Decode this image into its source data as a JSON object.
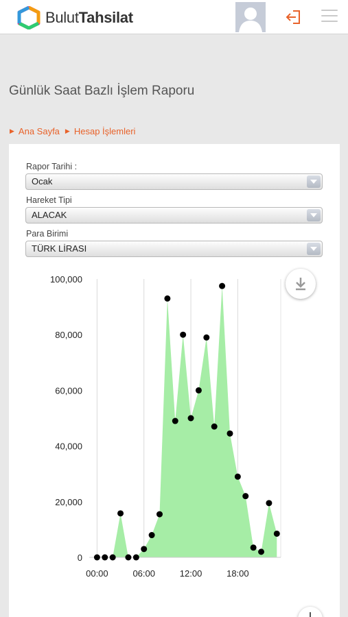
{
  "header": {
    "logo_text_regular": "Bulut",
    "logo_text_bold": "Tahsilat"
  },
  "icons": {
    "logo": "hexagon-logo-icon",
    "avatar": "user-avatar-icon",
    "logout": "logout-icon",
    "menu": "hamburger-menu-icon",
    "download": "download-icon",
    "zoom": "plus-icon"
  },
  "page": {
    "title": "Günlük Saat Bazlı İşlem Raporu"
  },
  "breadcrumb": {
    "items": [
      "Ana Sayfa",
      "Hesap İşlemleri"
    ]
  },
  "form": {
    "report_date": {
      "label": "Rapor Tarihi :",
      "value": "Ocak"
    },
    "movement_type": {
      "label": "Hareket Tipi",
      "value": "ALACAK"
    },
    "currency": {
      "label": "Para Birimi",
      "value": "TÜRK LİRASI"
    }
  },
  "colors": {
    "accent": "#e8622a",
    "area_fill": "#a6eda6",
    "point": "#000000"
  },
  "chart_data": {
    "type": "area",
    "x": [
      0,
      1,
      2,
      3,
      4,
      5,
      6,
      7,
      8,
      9,
      10,
      11,
      12,
      13,
      14,
      15,
      16,
      17,
      18,
      19,
      20,
      21,
      22,
      23
    ],
    "y": [
      0,
      0,
      0,
      15800,
      0,
      0,
      3000,
      8000,
      15500,
      93000,
      49000,
      80000,
      50000,
      60000,
      79000,
      47000,
      97500,
      44500,
      29000,
      22000,
      3500,
      2000,
      19500,
      8500
    ],
    "xticks": [
      "00:00",
      "06:00",
      "12:00",
      "18:00"
    ],
    "xtick_values": [
      0,
      6,
      12,
      18
    ],
    "yticks": [
      "0",
      "20,000",
      "40,000",
      "60,000",
      "80,000",
      "100,000"
    ],
    "ytick_values": [
      0,
      20000,
      40000,
      60000,
      80000,
      100000
    ],
    "xlim": [
      -1,
      23.5
    ],
    "ylim": [
      0,
      100000
    ],
    "grid": true,
    "markers": true
  }
}
